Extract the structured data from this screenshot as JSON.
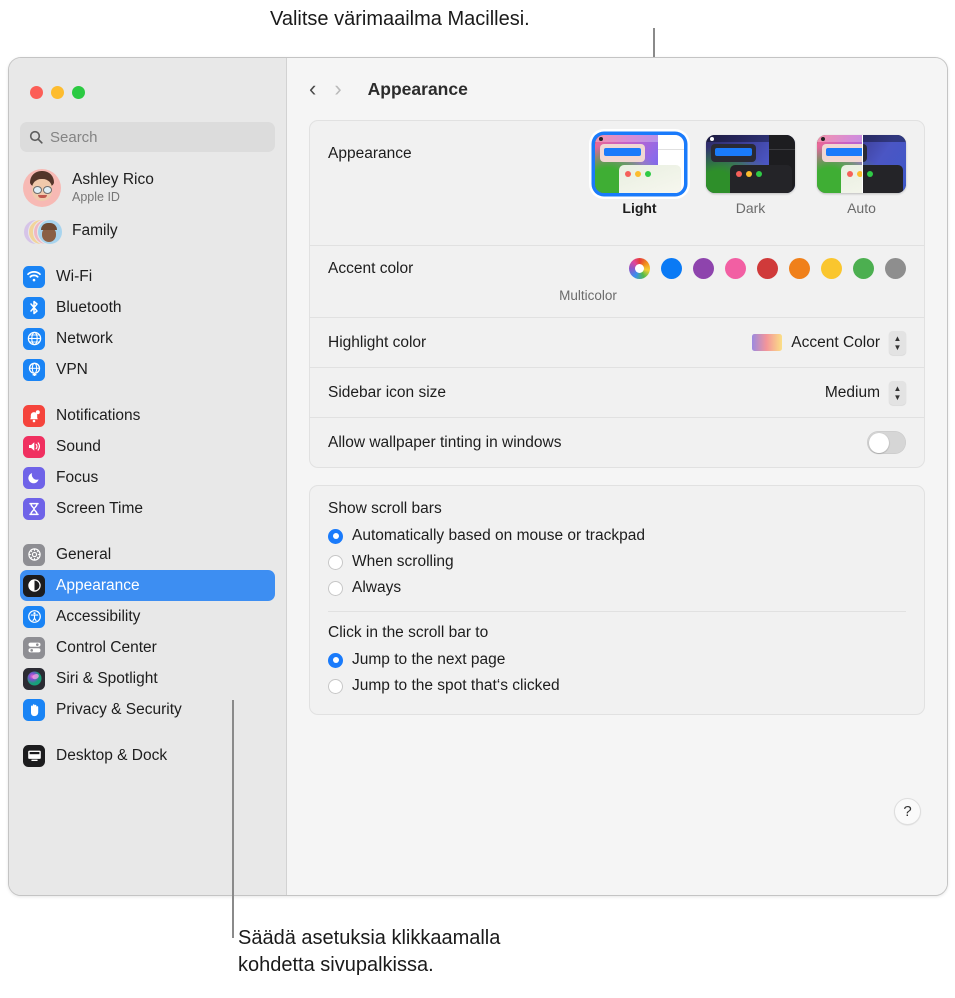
{
  "callouts": {
    "top": "Valitse värimaailma Macillesi.",
    "bottom": "Säädä asetuksia klikkaamalla\nkohdetta sivupalkissa."
  },
  "window": {
    "traffic_lights": [
      {
        "name": "close",
        "color": "#FC5E57"
      },
      {
        "name": "minimize",
        "color": "#FDBC2F"
      },
      {
        "name": "zoom",
        "color": "#2BCA42"
      }
    ]
  },
  "toolbar": {
    "back": "‹",
    "forward": "›",
    "title": "Appearance"
  },
  "sidebar": {
    "search": {
      "placeholder": "Search",
      "value": ""
    },
    "profile": {
      "name": "Ashley Rico",
      "subtitle": "Apple ID"
    },
    "family": {
      "label": "Family"
    },
    "groups": [
      {
        "items": [
          {
            "label": "Wi-Fi",
            "icon": "wifi-icon",
            "color": "#1a84f5"
          },
          {
            "label": "Bluetooth",
            "icon": "bluetooth-icon",
            "color": "#1a84f5"
          },
          {
            "label": "Network",
            "icon": "globe-icon",
            "color": "#1a84f5"
          },
          {
            "label": "VPN",
            "icon": "vpn-icon",
            "color": "#1a84f5"
          }
        ]
      },
      {
        "items": [
          {
            "label": "Notifications",
            "icon": "bell-icon",
            "color": "#f5443c"
          },
          {
            "label": "Sound",
            "icon": "speaker-icon",
            "color": "#f03060"
          },
          {
            "label": "Focus",
            "icon": "moon-icon",
            "color": "#6f63e8"
          },
          {
            "label": "Screen Time",
            "icon": "hourglass-icon",
            "color": "#6f63e8"
          }
        ]
      },
      {
        "items": [
          {
            "label": "General",
            "icon": "gear-icon",
            "color": "#8e8e93"
          },
          {
            "label": "Appearance",
            "icon": "appearance-icon",
            "color": "#1c1c1e",
            "selected": true
          },
          {
            "label": "Accessibility",
            "icon": "accessibility-icon",
            "color": "#1a84f5"
          },
          {
            "label": "Control Center",
            "icon": "control-center-icon",
            "color": "#8e8e93"
          },
          {
            "label": "Siri & Spotlight",
            "icon": "siri-icon",
            "color": "#2b2b33"
          },
          {
            "label": "Privacy & Security",
            "icon": "hand-icon",
            "color": "#1a84f5"
          }
        ]
      },
      {
        "items": [
          {
            "label": "Desktop & Dock",
            "icon": "desktop-icon",
            "color": "#1c1c1e"
          }
        ]
      }
    ]
  },
  "main": {
    "appearance": {
      "label": "Appearance",
      "options": [
        {
          "label": "Light",
          "selected": true
        },
        {
          "label": "Dark",
          "selected": false
        },
        {
          "label": "Auto",
          "selected": false
        }
      ]
    },
    "accent_color": {
      "label": "Accent color",
      "caption": "Multicolor",
      "swatches": [
        {
          "name": "Multicolor",
          "color": "multicolor",
          "selected": true
        },
        {
          "name": "Blue",
          "color": "#0A7AF5"
        },
        {
          "name": "Purple",
          "color": "#8E44AD"
        },
        {
          "name": "Pink",
          "color": "#F25FA3"
        },
        {
          "name": "Red",
          "color": "#D03A3A"
        },
        {
          "name": "Orange",
          "color": "#F0801A"
        },
        {
          "name": "Yellow",
          "color": "#FAC62E"
        },
        {
          "name": "Green",
          "color": "#4CAF50"
        },
        {
          "name": "Graphite",
          "color": "#8E8E8E"
        }
      ]
    },
    "highlight_color": {
      "label": "Highlight color",
      "value": "Accent Color"
    },
    "sidebar_icon_size": {
      "label": "Sidebar icon size",
      "value": "Medium"
    },
    "wallpaper_tinting": {
      "label": "Allow wallpaper tinting in windows",
      "enabled": false
    },
    "show_scroll_bars": {
      "title": "Show scroll bars",
      "options": [
        {
          "label": "Automatically based on mouse or trackpad",
          "selected": true
        },
        {
          "label": "When scrolling",
          "selected": false
        },
        {
          "label": "Always",
          "selected": false
        }
      ]
    },
    "click_scroll_bar": {
      "title": "Click in the scroll bar to",
      "options": [
        {
          "label": "Jump to the next page",
          "selected": true
        },
        {
          "label": "Jump to the spot that‘s clicked",
          "selected": false
        }
      ]
    },
    "help": "?"
  }
}
